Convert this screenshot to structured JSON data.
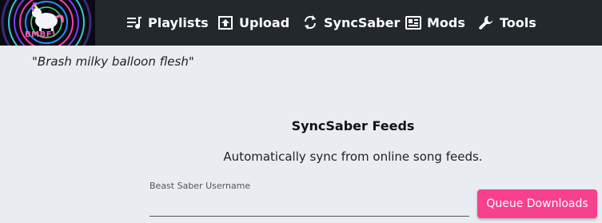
{
  "navbar": {
    "logo_text": "BMBF!",
    "items": [
      {
        "label": "Playlists",
        "icon": "playlist-icon"
      },
      {
        "label": "Upload",
        "icon": "upload-icon"
      },
      {
        "label": "SyncSaber",
        "icon": "sync-icon"
      },
      {
        "label": "Mods",
        "icon": "mods-icon"
      },
      {
        "label": "Tools",
        "icon": "wrench-icon"
      }
    ]
  },
  "main": {
    "quote": "\"Brash milky balloon flesh\"",
    "title": "SyncSaber Feeds",
    "description": "Automatically sync from online song feeds.",
    "username_field": {
      "label": "Beast Saber Username",
      "value": ""
    },
    "queue_button": "Queue Downloads"
  },
  "colors": {
    "navbar_bg": "#23282d",
    "page_bg": "#e9edf1",
    "accent": "#f7408e"
  }
}
